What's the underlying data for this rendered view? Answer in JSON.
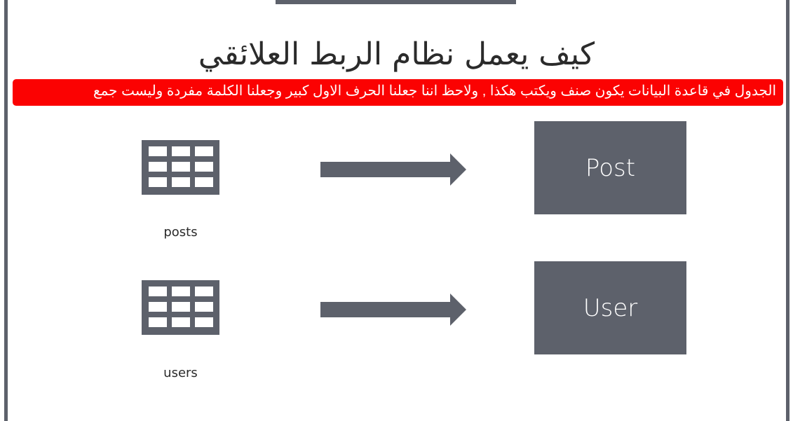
{
  "title": "كيف يعمل نظام الربط العلائقي",
  "note": "الجدول في قاعدة البيانات يكون صنف ويكتب هكذا , ولاحظ اننا جعلنا الحرف الاول كبير وجعلنا الكلمة مفردة وليست جمع",
  "colors": {
    "frame": "#5d616b",
    "note_bg": "#fb0202",
    "box": "#5d616b"
  },
  "rows": [
    {
      "table_name": "posts",
      "model_name": "Post"
    },
    {
      "table_name": "users",
      "model_name": "User"
    }
  ]
}
